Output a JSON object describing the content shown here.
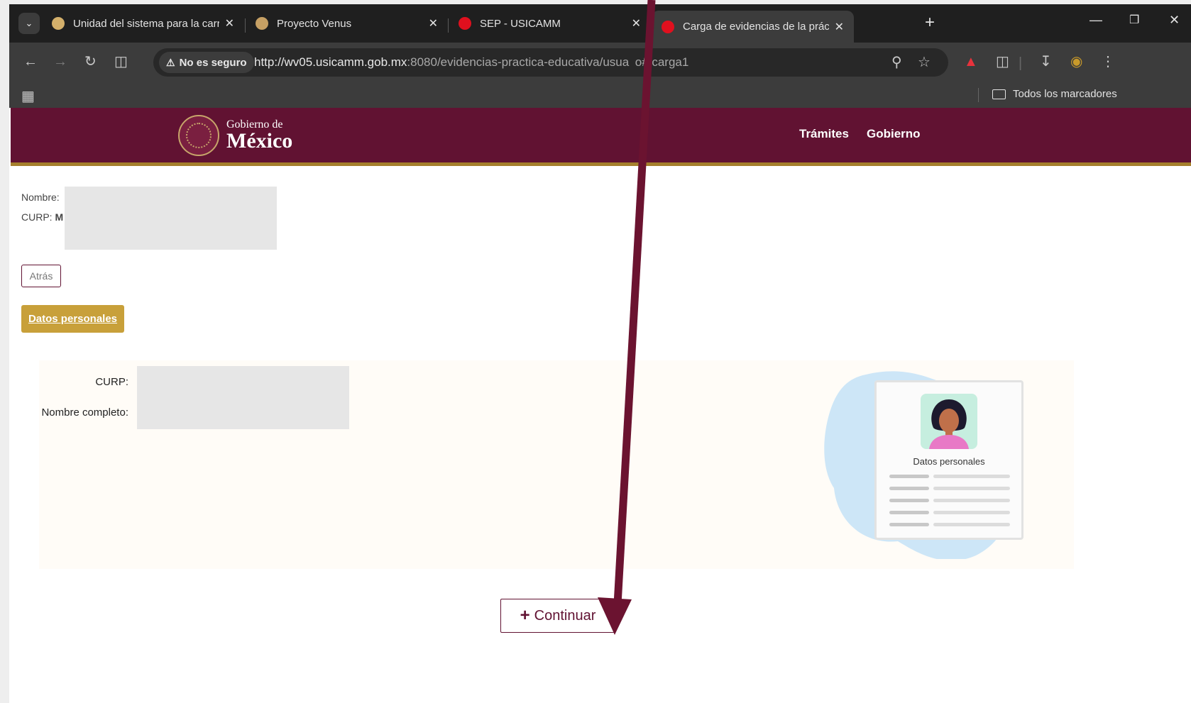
{
  "browser": {
    "tabs": [
      {
        "title": "Unidad del sistema para la carre",
        "favicon_color": "#d4b06b",
        "active": false
      },
      {
        "title": "Proyecto Venus",
        "favicon_color": "#c6a064",
        "active": false
      },
      {
        "title": "SEP - USICAMM",
        "favicon_color": "#e0101e",
        "active": false
      },
      {
        "title": "Carga de evidencias de la prácti",
        "favicon_color": "#e0101e",
        "active": true
      }
    ],
    "security_label": "No es seguro",
    "url_host": "http://wv05.usicamm.gob.mx",
    "url_path": ":8080/evidencias-practica-educativa/usua o#/carga1",
    "bookmarks_all": "Todos los marcadores"
  },
  "header": {
    "logo_line1": "Gobierno de",
    "logo_line2": "México",
    "nav": [
      "Trámites",
      "Gobierno"
    ],
    "brand_color": "#611232",
    "accent_color": "#a57f2c"
  },
  "user": {
    "nombre_label": "Nombre:",
    "curp_label": "CURP:",
    "curp_value_partial": "M"
  },
  "buttons": {
    "back": "Atrás",
    "datos_personales": "Datos personales",
    "continuar": "Continuar"
  },
  "form": {
    "curp_label": "CURP:",
    "nombre_completo_label": "Nombre completo:"
  },
  "illustration": {
    "card_title": "Datos personales"
  }
}
